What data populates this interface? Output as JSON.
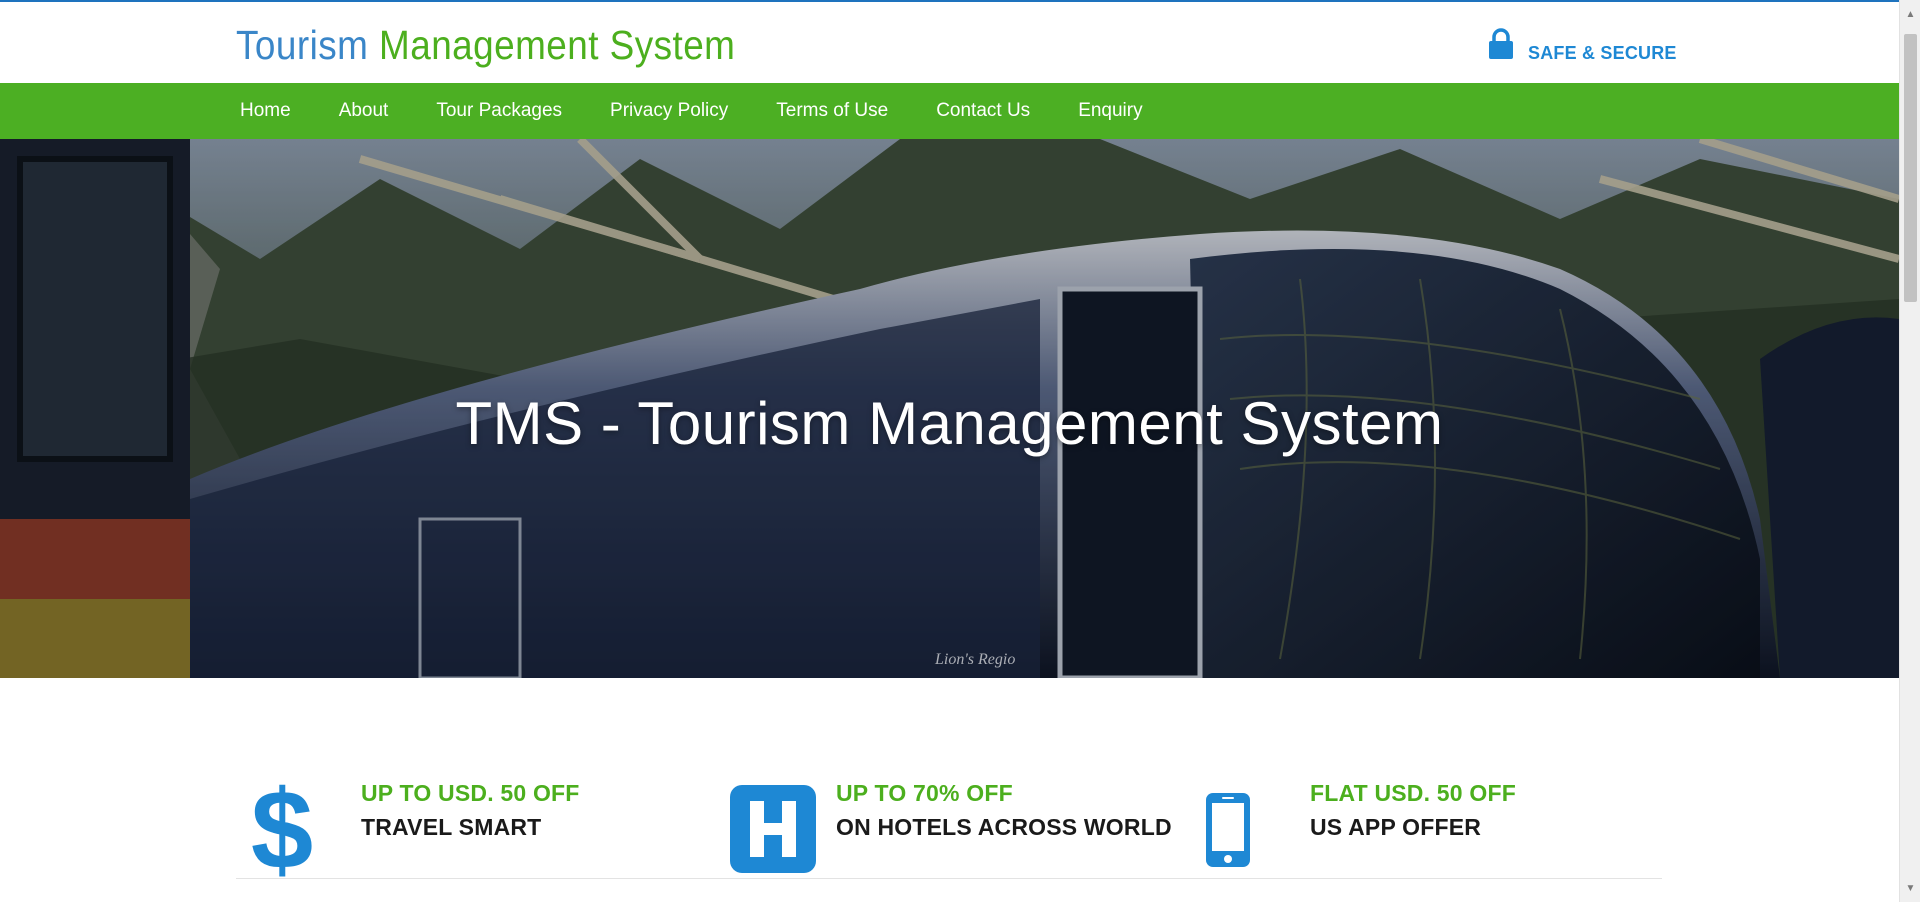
{
  "header": {
    "logo_part1": "Tourism",
    "logo_part2": "Management System",
    "secure_label": "SAFE & SECURE",
    "secure_icon": "lock-icon"
  },
  "nav": {
    "items": [
      {
        "label": "Home"
      },
      {
        "label": "About"
      },
      {
        "label": "Tour Packages"
      },
      {
        "label": "Privacy Policy"
      },
      {
        "label": "Terms of Use"
      },
      {
        "label": "Contact Us"
      },
      {
        "label": "Enquiry"
      }
    ]
  },
  "hero": {
    "title": "TMS - Tourism Management System"
  },
  "promos": [
    {
      "icon": "dollar-icon",
      "headline": "UP TO USD. 50 OFF",
      "subline": "TRAVEL SMART"
    },
    {
      "icon": "hospital-h-icon",
      "headline": "UP TO 70% OFF",
      "subline": "ON HOTELS ACROSS WORLD"
    },
    {
      "icon": "mobile-phone-icon",
      "headline": "FLAT USD. 50 OFF",
      "subline": "US APP OFFER"
    }
  ],
  "colors": {
    "brand_blue": "#3a86c8",
    "brand_green": "#4caf1e",
    "nav_green": "#4caf23",
    "icon_blue": "#1e88d4"
  }
}
